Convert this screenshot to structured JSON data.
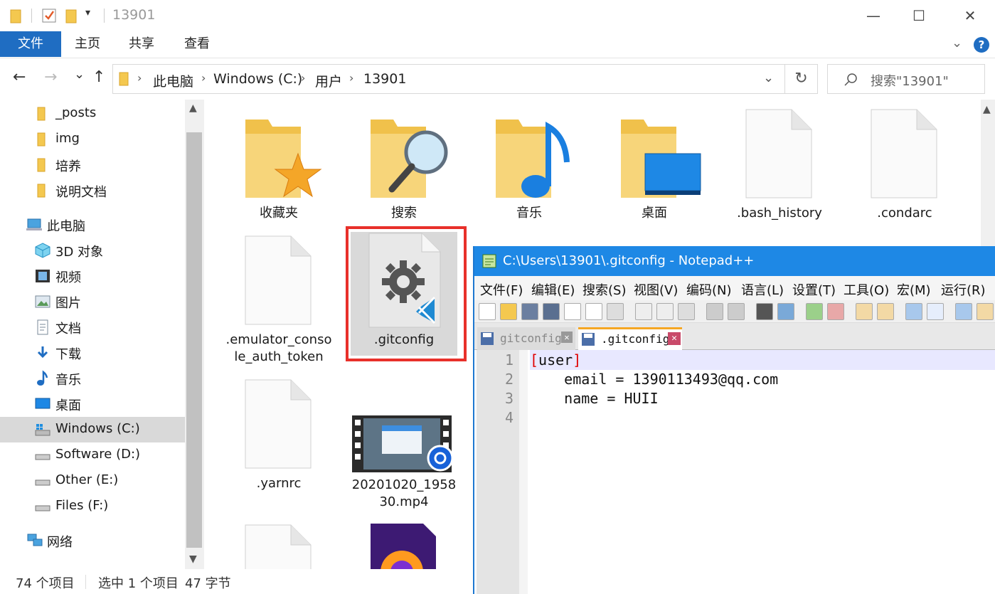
{
  "titlebar": {
    "title": "13901",
    "minimize": "—",
    "maximize": "☐",
    "close": "✕"
  },
  "ribbon": {
    "tabs": [
      "文件",
      "主页",
      "共享",
      "查看"
    ],
    "help": "?"
  },
  "navigation": {
    "back": "←",
    "forward": "→",
    "recent": "⌄",
    "up": "↑",
    "breadcrumb": [
      "此电脑",
      "Windows (C:)",
      "用户",
      "13901"
    ],
    "search_placeholder": "搜索\"13901\""
  },
  "sidebar": {
    "quick_items": [
      "_posts",
      "img",
      "培养",
      "说明文档"
    ],
    "this_pc": "此电脑",
    "pc_items": [
      "3D 对象",
      "视频",
      "图片",
      "文档",
      "下载",
      "音乐",
      "桌面"
    ],
    "drives": [
      "Windows (C:)",
      "Software (D:)",
      "Other (E:)",
      "Files (F:)"
    ],
    "selected": "Windows (C:)",
    "network": "网络"
  },
  "files": [
    {
      "name": "收藏夹",
      "icon": "favorites-folder-icon"
    },
    {
      "name": "搜索",
      "icon": "search-folder-icon"
    },
    {
      "name": "音乐",
      "icon": "music-folder-icon"
    },
    {
      "name": "桌面",
      "icon": "desktop-folder-icon"
    },
    {
      "name": ".bash_history",
      "icon": "blank-file-icon"
    },
    {
      "name": ".condarc",
      "icon": "blank-file-icon"
    },
    {
      "name": ".emulator_console_auth_token",
      "icon": "blank-file-icon"
    },
    {
      "name": ".gitconfig",
      "icon": "vscode-config-file-icon"
    },
    {
      "name": ".yarnrc",
      "icon": "blank-file-icon"
    },
    {
      "name": "20201020_195830.mp4",
      "icon": "video-file-icon"
    }
  ],
  "status": {
    "count": "74 个项目",
    "selection": "选中 1 个项目",
    "size": "47 字节"
  },
  "notepad": {
    "title": "C:\\Users\\13901\\.gitconfig - Notepad++",
    "menu": [
      "文件(F)",
      "编辑(E)",
      "搜索(S)",
      "视图(V)",
      "编码(N)",
      "语言(L)",
      "设置(T)",
      "工具(O)",
      "宏(M)",
      "运行(R)"
    ],
    "tabs": [
      {
        "label": "gitconfig",
        "active": false
      },
      {
        "label": ".gitconfig",
        "active": true
      }
    ],
    "line_numbers": [
      "1",
      "2",
      "3",
      "4"
    ],
    "lines": [
      "[user]",
      "    email = 1390113493@qq.com",
      "    name = HUII",
      ""
    ]
  },
  "colors": {
    "accent": "#1f6dc2",
    "notepad_title": "#1e88e5",
    "highlight_border": "#e8302a",
    "bracket": "#e00000"
  }
}
